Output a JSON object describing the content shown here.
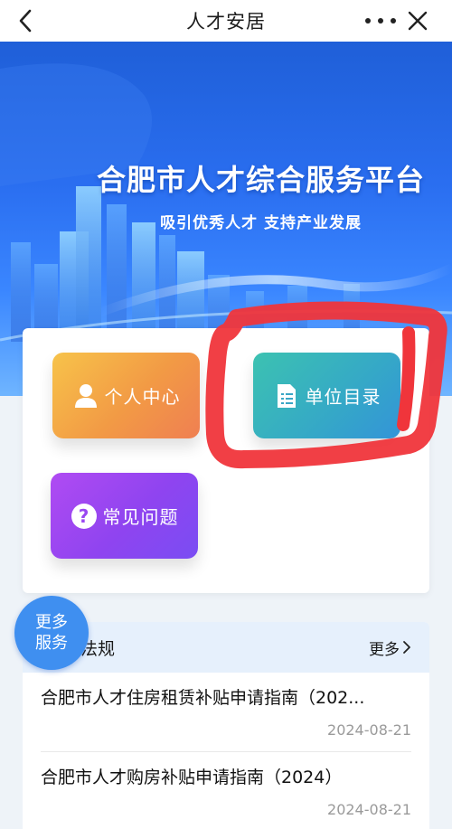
{
  "navbar": {
    "title": "人才安居",
    "back_icon": "chevron-left-icon",
    "more_icon": "more-dots-icon",
    "close_icon": "close-icon"
  },
  "banner": {
    "title": "合肥市人才综合服务平台",
    "subtitle": "吸引优秀人才 支持产业发展"
  },
  "services": {
    "personal_center": {
      "label": "个人中心",
      "icon": "user-icon"
    },
    "unit_directory": {
      "label": "单位目录",
      "icon": "document-list-icon"
    },
    "faq": {
      "label": "常见问题",
      "icon": "question-icon"
    }
  },
  "floating_button": {
    "line1": "更多",
    "line2": "服务"
  },
  "news": {
    "title_fragment": "法规",
    "more_label": "更多",
    "items": [
      {
        "title": "合肥市人才住房租赁补贴申请指南（202...",
        "date": "2024-08-21"
      },
      {
        "title": "合肥市人才购房补贴申请指南（2024）",
        "date": "2024-08-21"
      }
    ]
  },
  "colors": {
    "accent_blue": "#3f8ff0",
    "annotation_red": "#f0353b",
    "personal_tile": "#f2a046",
    "unit_tile": "#35a8c7",
    "faq_tile": "#9447f1"
  }
}
